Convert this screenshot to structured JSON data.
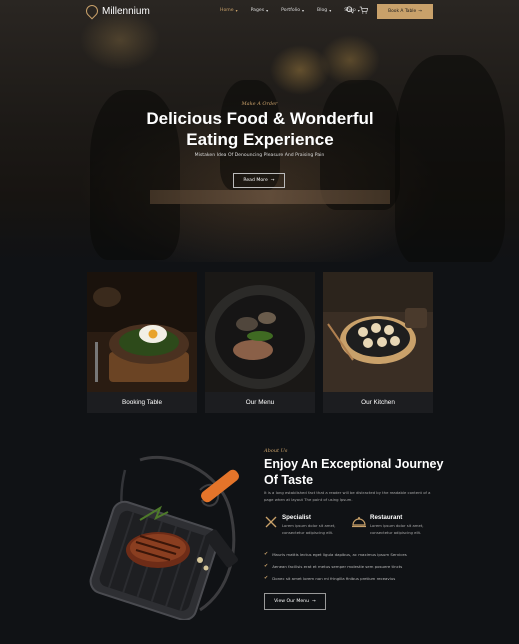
{
  "brand": {
    "name": "Millennium"
  },
  "nav": {
    "items": [
      {
        "label": "Home",
        "active": true
      },
      {
        "label": "Pages"
      },
      {
        "label": "Portfolio"
      },
      {
        "label": "Blog"
      },
      {
        "label": "Shop"
      }
    ],
    "search_icon": "search-icon",
    "cart_icon": "cart-icon",
    "book_label": "Book A Table"
  },
  "hero": {
    "tagline": "Make A Order",
    "title": "Delicious Food & Wonderful Eating Experience",
    "subtitle": "Mistaken Idea Of Denouncing Pleasure And Praising Pain",
    "button_label": "Read More"
  },
  "cards": [
    {
      "label": "Booking Table"
    },
    {
      "label": "Our Menu"
    },
    {
      "label": "Our Kitchen"
    }
  ],
  "about": {
    "eyebrow": "About Us",
    "title": "Enjoy An Exceptional Journey Of Taste",
    "description": "It is a long established fact that a reader will be distracted by the readable content of a page when at layout The point of using Ipsum.",
    "features": [
      {
        "title": "Specialist",
        "description": "Lorem ipsum dolor sit amet, consectetur adipiscing elit.",
        "icon": "utensils-icon"
      },
      {
        "title": "Restaurant",
        "description": "Lorem ipsum dolor sit amet, consectetur adipiscing elit.",
        "icon": "cloche-icon"
      }
    ],
    "checklist": [
      "Mauris mattis lectus eget ligula dapibus, ac maximus ipsum Services",
      "Aenean facilisis erat et metus semper molestie sem posuere tincts",
      "Donec sit amet lorem non mi fringilla finibus pretium receavius"
    ],
    "button_label": "View Our Menu"
  },
  "colors": {
    "accent": "#c9a16a",
    "background": "#101215",
    "card": "#1b1c1f"
  }
}
